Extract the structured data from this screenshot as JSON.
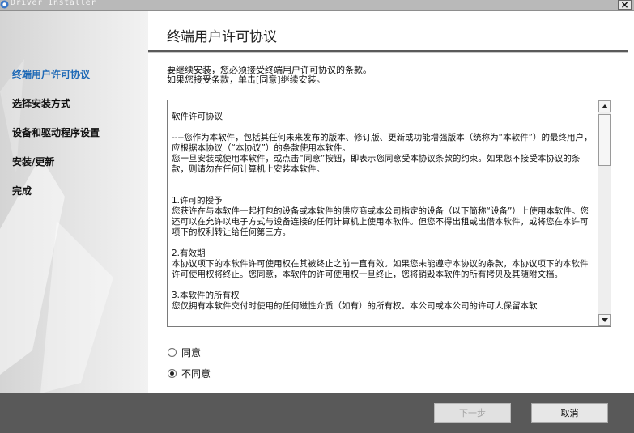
{
  "window": {
    "title": "Driver Installer",
    "close_glyph": "×"
  },
  "sidebar": {
    "steps": [
      {
        "label": "终端用户许可协议",
        "active": true
      },
      {
        "label": "选择安装方式",
        "active": false
      },
      {
        "label": "设备和驱动程序设置",
        "active": false
      },
      {
        "label": "安装/更新",
        "active": false
      },
      {
        "label": "完成",
        "active": false
      }
    ]
  },
  "header": {
    "title": "终端用户许可协议"
  },
  "intro": {
    "line1": "要继续安装，您必须接受终端用户许可协议的条款。",
    "line2": "如果您接受条款，单击[同意]继续安装。"
  },
  "license": {
    "heading": "软件许可协议",
    "para1": "----您作为本软件，包括其任何未来发布的版本、修订版、更新或功能增强版本（统称为“本软件”）的最终用户，应根据本协议（“本协议”）的条款使用本软件。",
    "para1b": "您一旦安装或使用本软件，或点击“同意”按钮，即表示您同意受本协议条款的约束。如果您不接受本协议的条款，则请勿在任何计算机上安装本软件。",
    "s1_title": "1.许可的授予",
    "s1_body": "您获许在与本软件一起打包的设备或本软件的供应商或本公司指定的设备（以下简称“设备”）上使用本软件。您还可以在允许以电子方式与设备连接的任何计算机上使用本软件。但您不得出租或出借本软件，或将您在本许可项下的权利转让给任何第三方。",
    "s2_title": "2.有效期",
    "s2_body": "本协议项下的本软件许可使用权在其被终止之前一直有效。如果您未能遵守本协议的条款，本协议项下的本软件许可使用权将终止。您同意，本软件的许可使用权一旦终止，您将销毁本软件的所有拷贝及其随附文档。",
    "s3_title": "3.本软件的所有权",
    "s3_body": "您仅拥有本软件交付时使用的任何磁性介质（如有）的所有权。本公司或本公司的许可人保留本软"
  },
  "options": {
    "agree": "同意",
    "disagree": "不同意",
    "selected": "disagree"
  },
  "buttons": {
    "next": "下一步",
    "cancel": "取消"
  },
  "colors": {
    "active_step": "#1e69b6",
    "bottom_bar": "#595959"
  }
}
